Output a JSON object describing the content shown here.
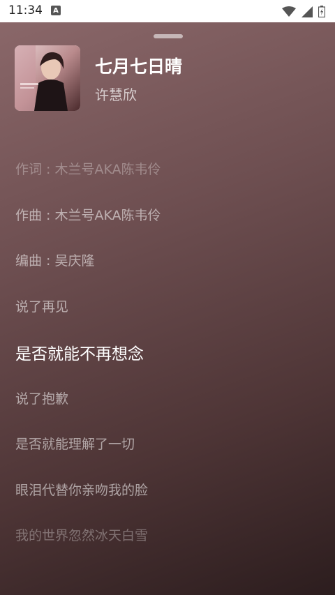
{
  "status": {
    "time": "11:34",
    "badge": "A"
  },
  "song": {
    "title": "七月七日晴",
    "artist": "许慧欣"
  },
  "lyrics": [
    {
      "text": "作词 : 木兰号AKA陈韦伶"
    },
    {
      "text": "作曲 : 木兰号AKA陈韦伶"
    },
    {
      "text": "编曲 : 吴庆隆"
    },
    {
      "text": "说了再见"
    },
    {
      "text": "是否就能不再想念",
      "active": true
    },
    {
      "text": "说了抱歉"
    },
    {
      "text": "是否就能理解了一切"
    },
    {
      "text": "眼泪代替你亲吻我的脸"
    },
    {
      "text": "我的世界忽然冰天白雪"
    }
  ],
  "icons": [
    "wifi-icon",
    "signal-icon",
    "battery-icon",
    "album-cover"
  ]
}
